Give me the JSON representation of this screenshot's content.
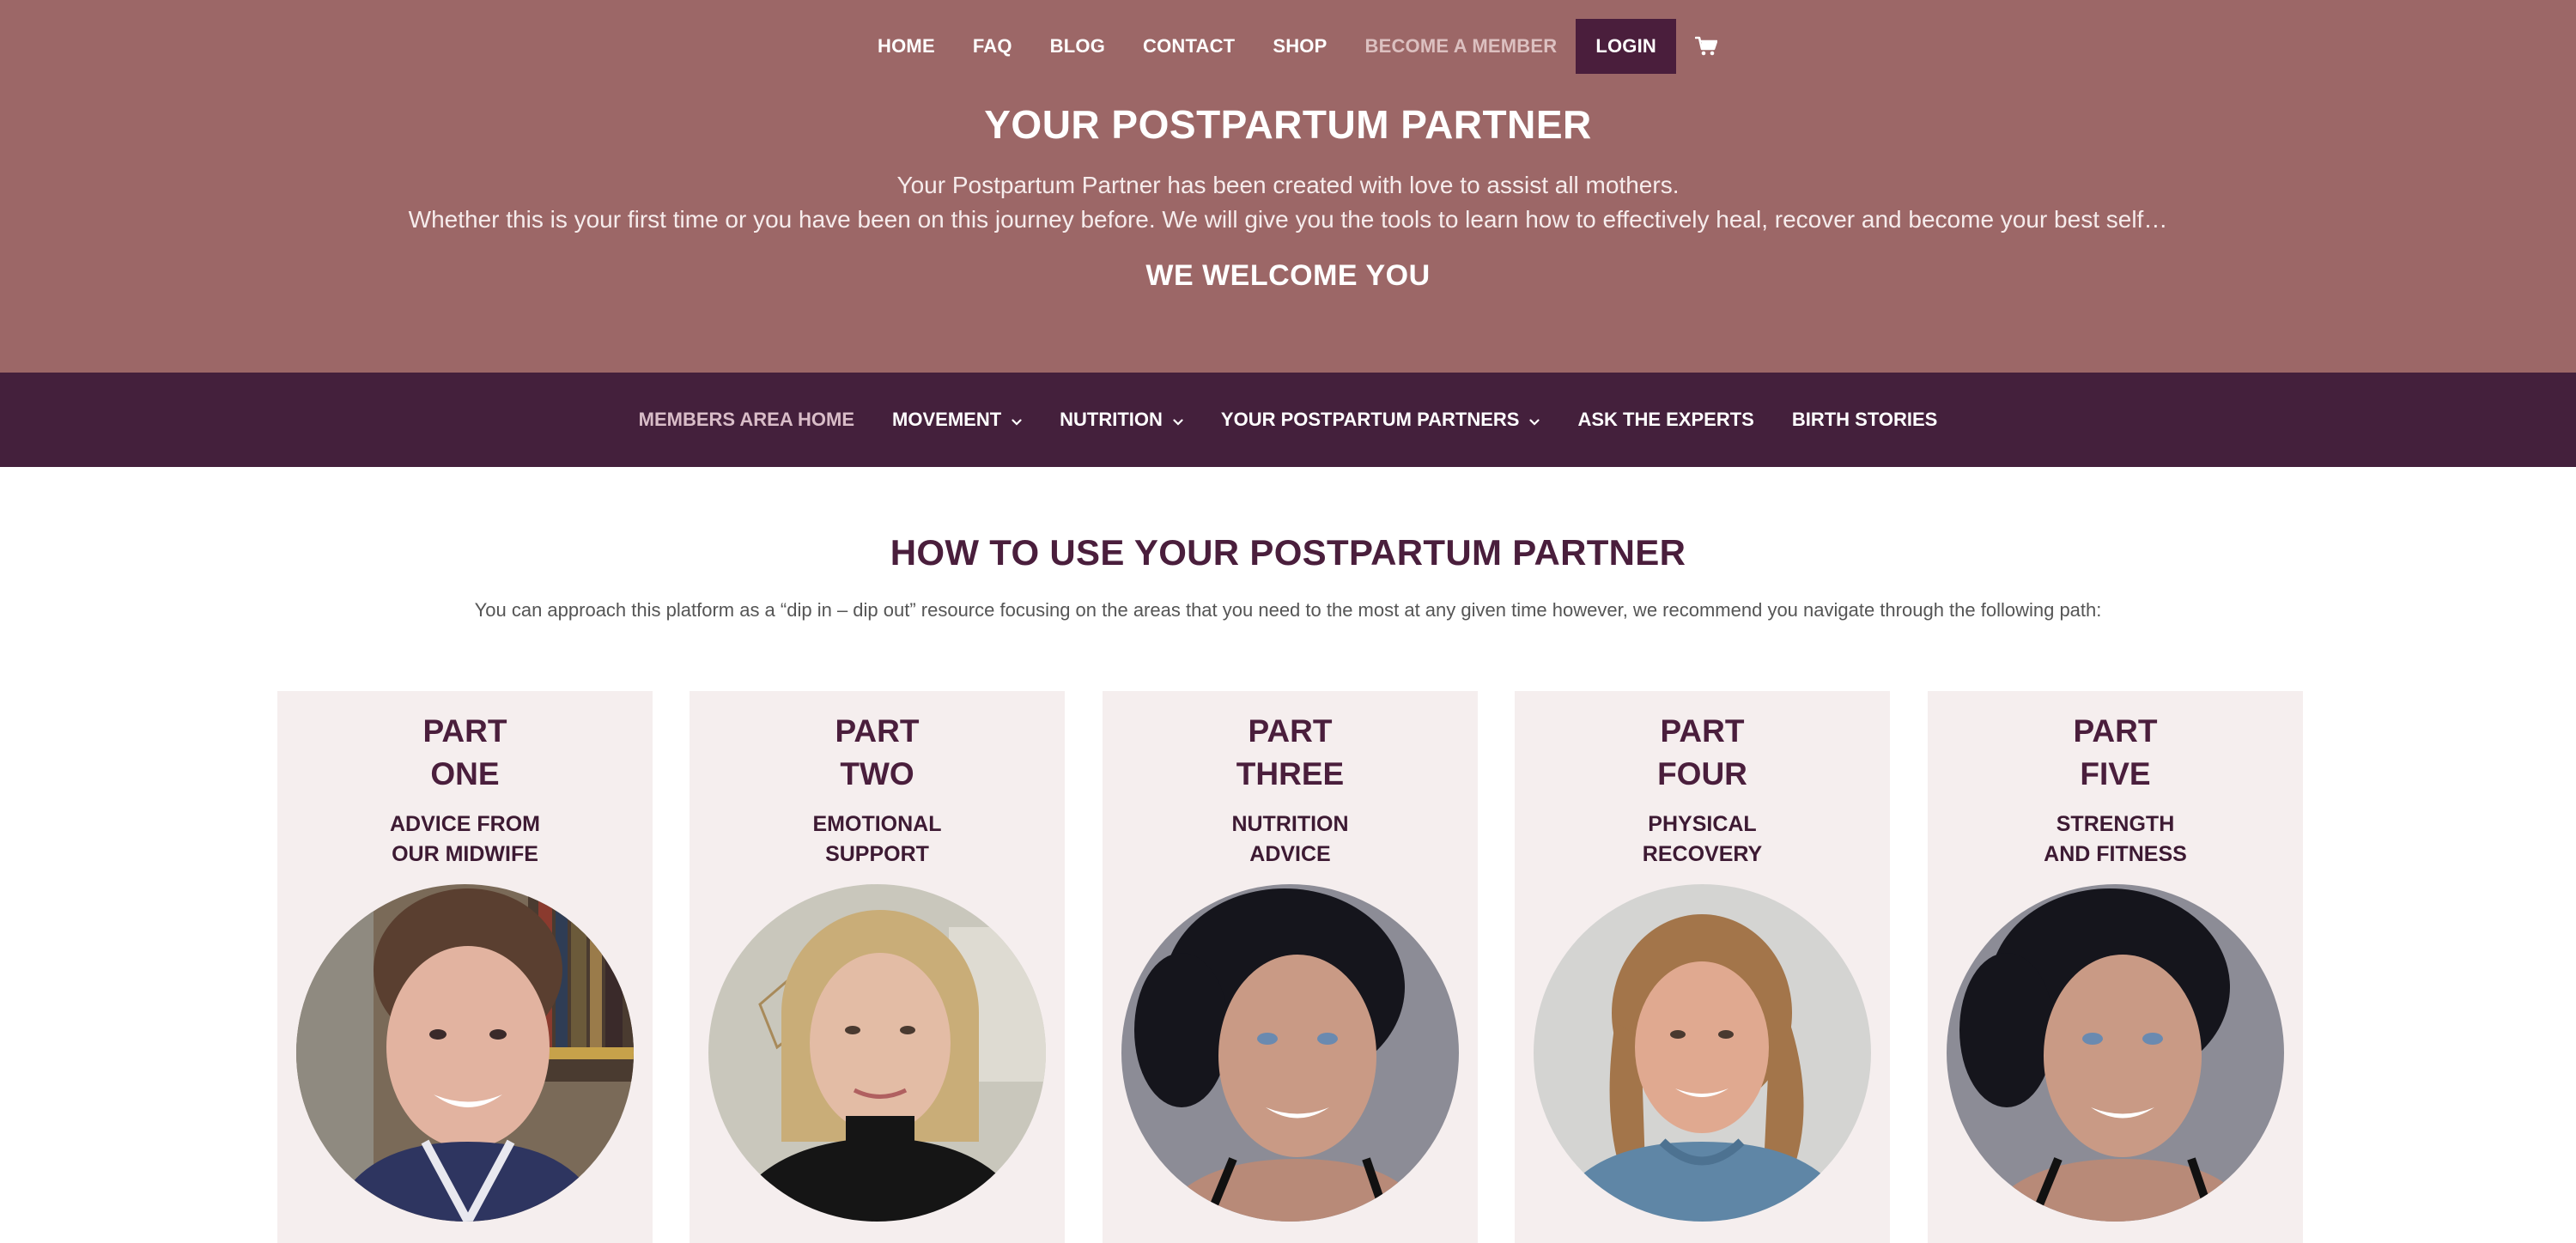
{
  "top_nav": {
    "items": [
      "HOME",
      "FAQ",
      "BLOG",
      "CONTACT",
      "SHOP",
      "BECOME A MEMBER"
    ],
    "login_label": "LOGIN",
    "cart_icon": "shopping-cart-icon"
  },
  "hero": {
    "title": "YOUR POSTPARTUM PARTNER",
    "line1": "Your Postpartum Partner has been created with love to assist all mothers.",
    "line2": "Whether this is your first time or you have been on this journey before. We will give you the tools to learn how to effectively heal, recover and become your best self…",
    "welcome": "WE WELCOME YOU"
  },
  "members_nav": {
    "items": [
      {
        "label": "MEMBERS AREA HOME",
        "dropdown": false
      },
      {
        "label": "MOVEMENT",
        "dropdown": true
      },
      {
        "label": "NUTRITION",
        "dropdown": true
      },
      {
        "label": "YOUR POSTPARTUM PARTNERS",
        "dropdown": true
      },
      {
        "label": "ASK THE EXPERTS",
        "dropdown": false
      },
      {
        "label": "BIRTH STORIES",
        "dropdown": false
      }
    ]
  },
  "section": {
    "title": "HOW TO USE YOUR POSTPARTUM PARTNER",
    "subtitle": "You can approach this platform as a “dip in – dip out” resource focusing on the areas that you need to the most at any given time however, we recommend you navigate through the following path:"
  },
  "cards": [
    {
      "part_line1": "PART",
      "part_line2": "ONE",
      "topic_line1": "ADVICE FROM",
      "topic_line2": "OUR MIDWIFE"
    },
    {
      "part_line1": "PART",
      "part_line2": "TWO",
      "topic_line1": "EMOTIONAL",
      "topic_line2": "SUPPORT"
    },
    {
      "part_line1": "PART",
      "part_line2": "THREE",
      "topic_line1": "NUTRITION",
      "topic_line2": "ADVICE"
    },
    {
      "part_line1": "PART",
      "part_line2": "FOUR",
      "topic_line1": "PHYSICAL",
      "topic_line2": "RECOVERY"
    },
    {
      "part_line1": "PART",
      "part_line2": "FIVE",
      "topic_line1": "STRENGTH",
      "topic_line2": "AND FITNESS"
    }
  ],
  "colors": {
    "hero_bg": "#9c6767",
    "members_nav_bg": "#44203c",
    "accent": "#4a1e3c",
    "card_bg": "#f5eeee"
  }
}
